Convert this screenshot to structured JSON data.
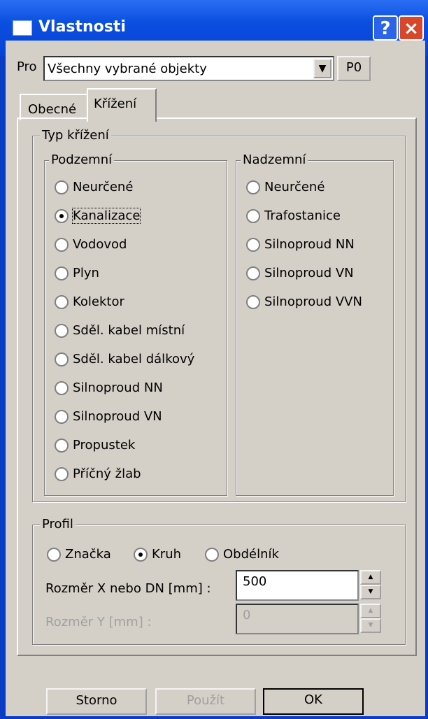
{
  "window": {
    "title": "Vlastnosti",
    "help": "?",
    "close": "×"
  },
  "pro": {
    "label": "Pro",
    "selected": "Všechny vybrané objekty",
    "button": "P0"
  },
  "tabs": [
    {
      "label": "Obecné"
    },
    {
      "label": "Křížení"
    }
  ],
  "typ_krizeni": {
    "legend": "Typ křížení",
    "podzemni": {
      "legend": "Podzemní",
      "items": [
        "Neurčené",
        "Kanalizace",
        "Vodovod",
        "Plyn",
        "Kolektor",
        "Sděl. kabel místní",
        "Sděl. kabel dálkový",
        "Silnoproud NN",
        "Silnoproud VN",
        "Propustek",
        "Příčný žlab"
      ],
      "selected": 1
    },
    "nadzemni": {
      "legend": "Nadzemní",
      "items": [
        "Neurčené",
        "Trafostanice",
        "Silnoproud NN",
        "Silnoproud VN",
        "Silnoproud VVN"
      ]
    }
  },
  "profil": {
    "legend": "Profil",
    "options": [
      "Značka",
      "Kruh",
      "Obdélník"
    ],
    "selected": 1,
    "rozmer_x": {
      "label": "Rozměr X nebo DN [mm] :",
      "value": "500"
    },
    "rozmer_y": {
      "label": "Rozměr Y [mm] :",
      "value": "0"
    }
  },
  "buttons": {
    "storno": "Storno",
    "pouzit": "Použít",
    "ok": "OK"
  }
}
